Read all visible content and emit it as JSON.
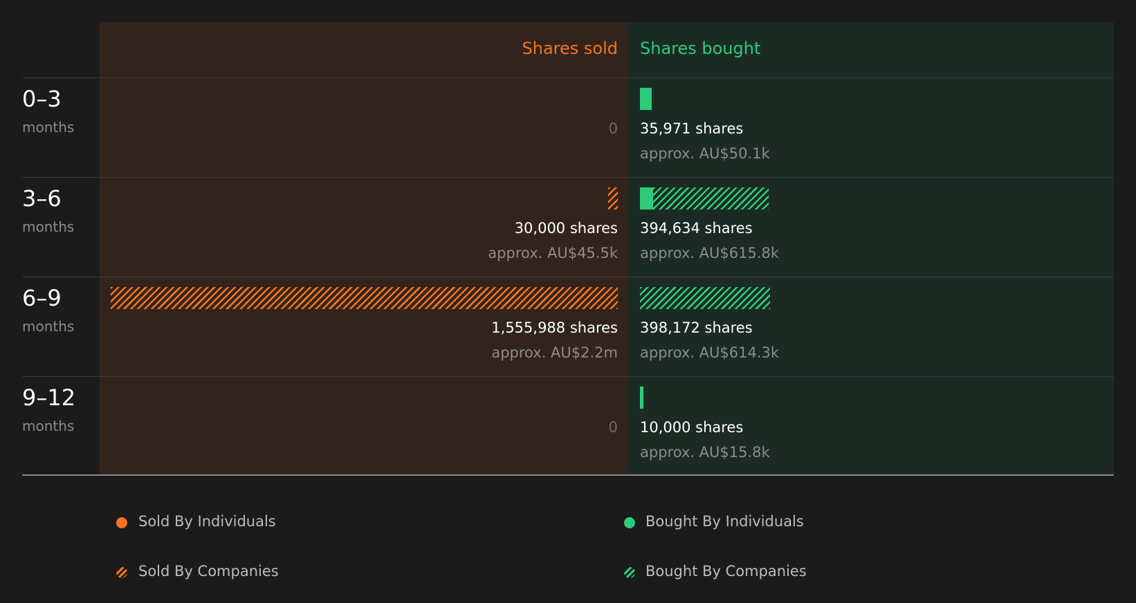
{
  "colors": {
    "sold": "#f47420",
    "bought": "#2ecc7a",
    "sold_panel": "#32241c",
    "bought_panel": "#1b2b24"
  },
  "header": {
    "sold_label": "Shares sold",
    "bought_label": "Shares bought"
  },
  "chart_data": {
    "type": "bar",
    "categories": [
      "0–3",
      "3–6",
      "6–9",
      "9–12"
    ],
    "unit_label": "months",
    "scale_max_shares": 1555988,
    "series": [
      {
        "name": "Sold By Individuals",
        "side": "sold",
        "style": "solid",
        "values": [
          0,
          0,
          0,
          0
        ]
      },
      {
        "name": "Sold By Companies",
        "side": "sold",
        "style": "hatched",
        "values": [
          0,
          30000,
          1555988,
          0
        ]
      },
      {
        "name": "Bought By Individuals",
        "side": "bought",
        "style": "solid",
        "values": [
          35971,
          40000,
          0,
          10000
        ]
      },
      {
        "name": "Bought By Companies",
        "side": "bought",
        "style": "hatched",
        "values": [
          0,
          354634,
          398172,
          0
        ]
      }
    ],
    "rows": [
      {
        "period": "0–3",
        "unit": "months",
        "sold_shares": "",
        "sold_value": "",
        "sold_zero": "0",
        "bought_shares": "35,971 shares",
        "bought_value": "approx. AU$50.1k"
      },
      {
        "period": "3–6",
        "unit": "months",
        "sold_shares": "30,000 shares",
        "sold_value": "approx. AU$45.5k",
        "sold_zero": "",
        "bought_shares": "394,634 shares",
        "bought_value": "approx. AU$615.8k"
      },
      {
        "period": "6–9",
        "unit": "months",
        "sold_shares": "1,555,988 shares",
        "sold_value": "approx. AU$2.2m",
        "sold_zero": "",
        "bought_shares": "398,172 shares",
        "bought_value": "approx. AU$614.3k"
      },
      {
        "period": "9–12",
        "unit": "months",
        "sold_shares": "",
        "sold_value": "",
        "sold_zero": "0",
        "bought_shares": "10,000 shares",
        "bought_value": "approx. AU$15.8k"
      }
    ],
    "legend": [
      {
        "label": "Sold By Individuals",
        "side": "sold",
        "style": "solid"
      },
      {
        "label": "Bought By Individuals",
        "side": "bought",
        "style": "solid"
      },
      {
        "label": "Sold By Companies",
        "side": "sold",
        "style": "hatched"
      },
      {
        "label": "Bought By Companies",
        "side": "bought",
        "style": "hatched"
      }
    ]
  }
}
